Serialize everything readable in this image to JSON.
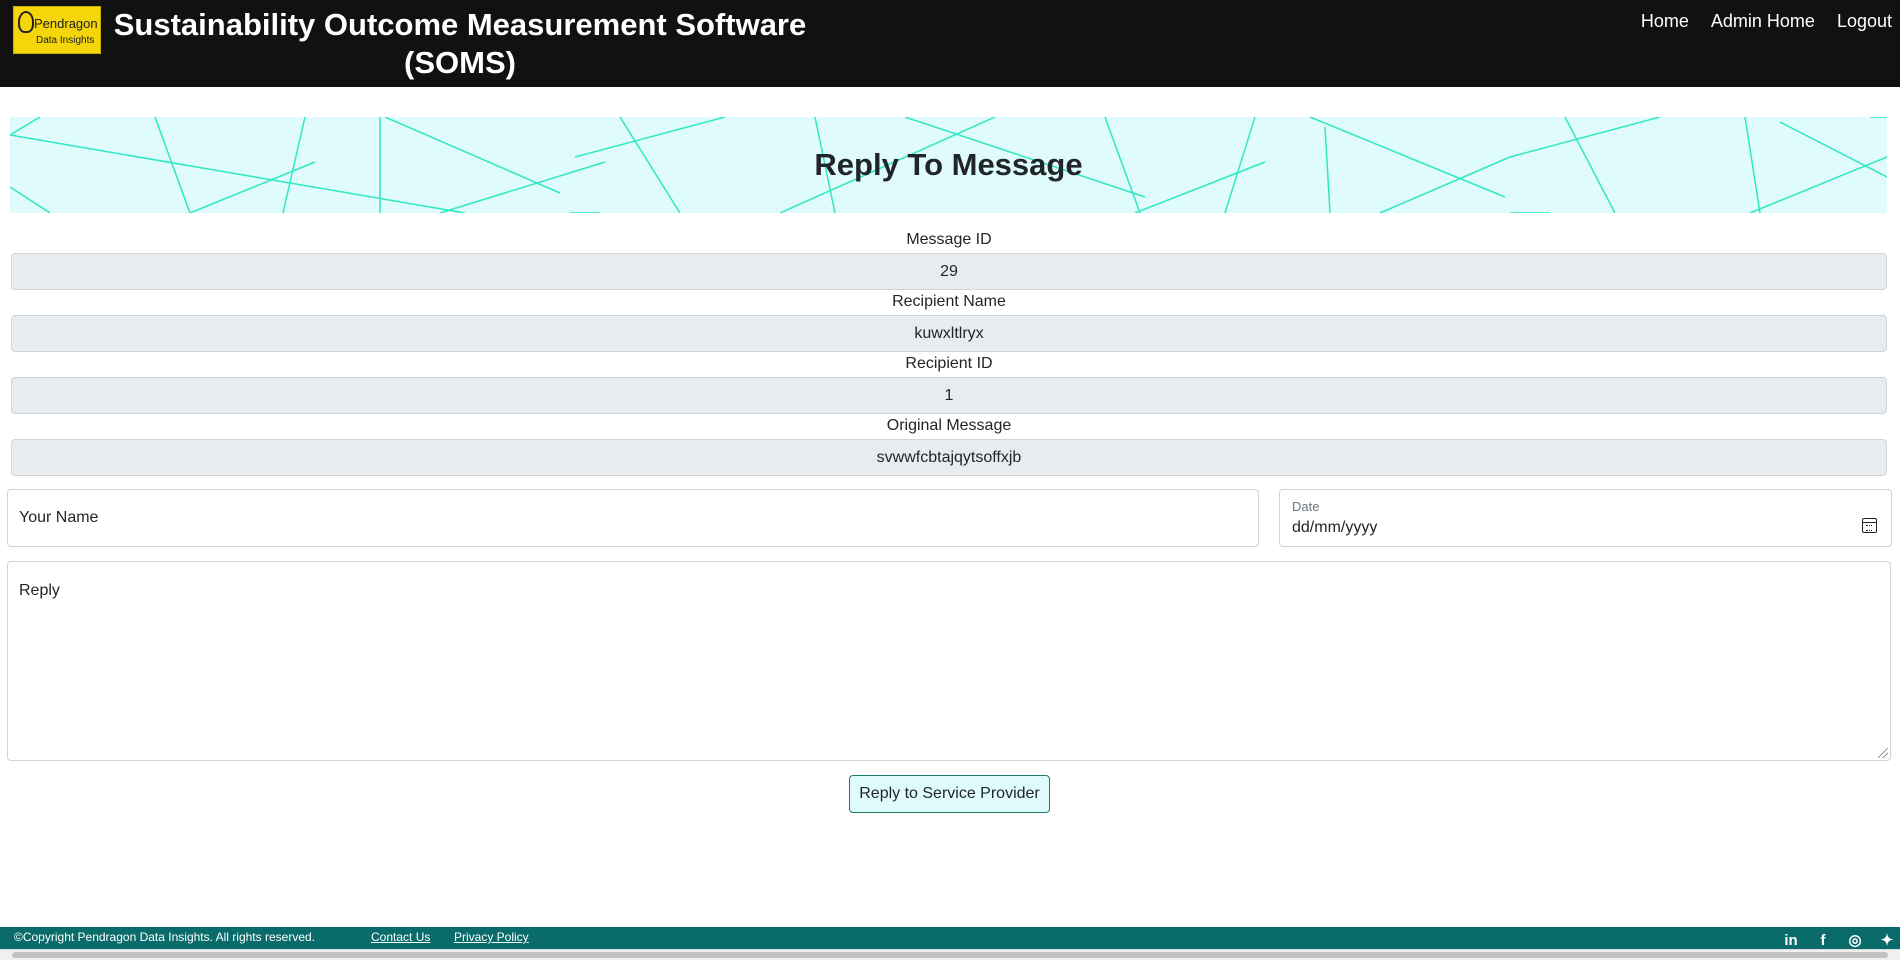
{
  "header": {
    "logo_text_line1": "Pendragon",
    "logo_text_line2": "Data Insights",
    "title": "Sustainability Outcome Measurement Software (SOMS)",
    "nav": [
      "Home",
      "Admin Home",
      "Logout"
    ]
  },
  "banner": {
    "title": "Reply To Message"
  },
  "fields": {
    "message_id": {
      "label": "Message ID",
      "value": "29"
    },
    "recipient_name": {
      "label": "Recipient Name",
      "value": "kuwxltlryx"
    },
    "recipient_id": {
      "label": "Recipient ID",
      "value": "1"
    },
    "original_message": {
      "label": "Original Message",
      "value": "svwwfcbtajqytsoffxjb"
    }
  },
  "form": {
    "your_name_placeholder": "Your Name",
    "date_label": "Date",
    "date_placeholder": "dd/mm/yyyy",
    "reply_placeholder": "Reply",
    "submit_label": "Reply to Service Provider"
  },
  "footer": {
    "copyright": "©Copyright Pendragon Data Insights. All rights reserved.",
    "contact": "Contact Us",
    "privacy": "Privacy Policy",
    "social_icons": [
      "linkedin-icon",
      "facebook-icon",
      "instagram-icon",
      "twitter-icon"
    ]
  },
  "colors": {
    "header_bg": "#111111",
    "banner_bg": "#e0fbfc",
    "banner_lines": "#2ee8c4",
    "footer_bg": "#0a6b6b"
  }
}
